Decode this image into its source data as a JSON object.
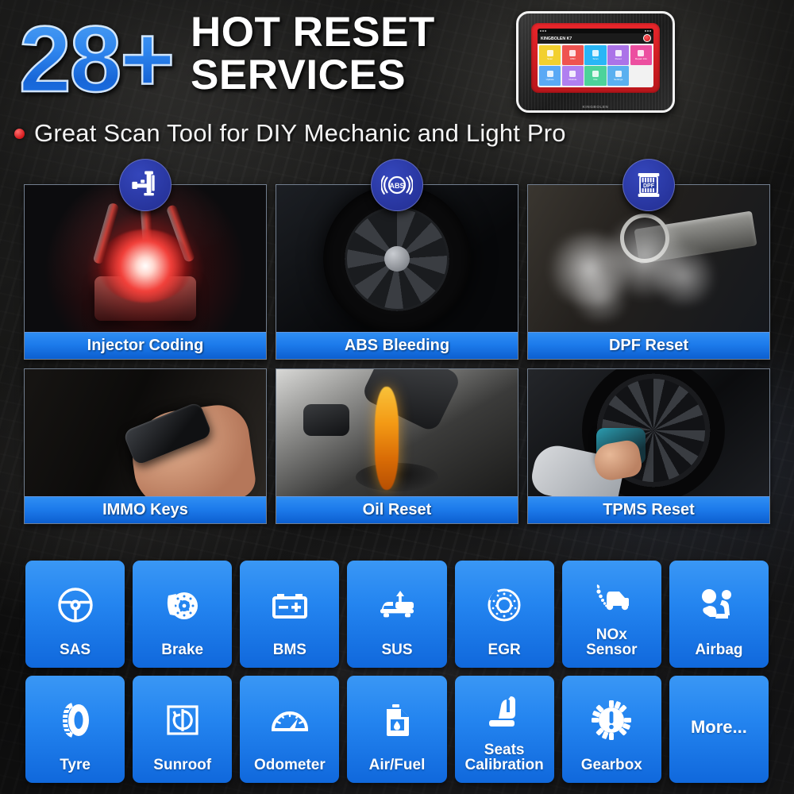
{
  "header": {
    "badge_number": "28+",
    "title_line1": "HOT RESET",
    "title_line2": "SERVICES",
    "subtitle": "Great Scan Tool for DIY Mechanic and Light Pro",
    "bullet_color": "#d3191c",
    "accent_blue": "#2485f0"
  },
  "device": {
    "brand_model": "KINGBOLEN K7",
    "chin_brand": "KINGBOLEN",
    "record_button": "record-indicator",
    "apps": [
      {
        "label": "Scan",
        "color": "#f2d02e"
      },
      {
        "label": "OBD",
        "color": "#ef5350"
      },
      {
        "label": "Scan",
        "color": "#29b6f6"
      },
      {
        "label": "Reset",
        "color": "#ab73e8"
      },
      {
        "label": "Repair Info",
        "color": "#ec4fa0"
      },
      {
        "label": "Update",
        "color": "#5aa9f5"
      },
      {
        "label": "Module",
        "color": "#b07ff0"
      },
      {
        "label": "File",
        "color": "#4cd39a"
      },
      {
        "label": "Settings",
        "color": "#5ab0f0"
      }
    ]
  },
  "cards": [
    {
      "label": "Injector Coding",
      "badge_icon": "fuel-injector-icon",
      "photo": "engine-combustion-photo"
    },
    {
      "label": "ABS Bleeding",
      "badge_icon": "abs-icon",
      "photo": "brake-wheel-photo"
    },
    {
      "label": "DPF Reset",
      "badge_icon": "dpf-filter-icon",
      "photo": "exhaust-smoke-photo"
    },
    {
      "label": "IMMO Keys",
      "badge_icon": null,
      "photo": "key-fob-photo"
    },
    {
      "label": "Oil Reset",
      "badge_icon": null,
      "photo": "oil-pour-photo"
    },
    {
      "label": "TPMS Reset",
      "badge_icon": null,
      "photo": "tpms-tool-photo"
    }
  ],
  "tiles": [
    {
      "label": "SAS",
      "icon": "steering-wheel-icon"
    },
    {
      "label": "Brake",
      "icon": "brake-disc-icon"
    },
    {
      "label": "BMS",
      "icon": "battery-icon"
    },
    {
      "label": "SUS",
      "icon": "suspension-car-icon"
    },
    {
      "label": "EGR",
      "icon": "egr-valve-icon"
    },
    {
      "label": "NOx\nSensor",
      "icon": "nox-sensor-car-icon"
    },
    {
      "label": "Airbag",
      "icon": "airbag-seat-icon"
    },
    {
      "label": "Tyre",
      "icon": "tyre-icon"
    },
    {
      "label": "Sunroof",
      "icon": "sunroof-icon"
    },
    {
      "label": "Odometer",
      "icon": "odometer-gauge-icon"
    },
    {
      "label": "Air/Fuel",
      "icon": "fuel-canister-icon"
    },
    {
      "label": "Seats\nCalibration",
      "icon": "car-seat-icon"
    },
    {
      "label": "Gearbox",
      "icon": "gear-warning-icon"
    },
    {
      "label": "More...",
      "icon": null
    }
  ]
}
